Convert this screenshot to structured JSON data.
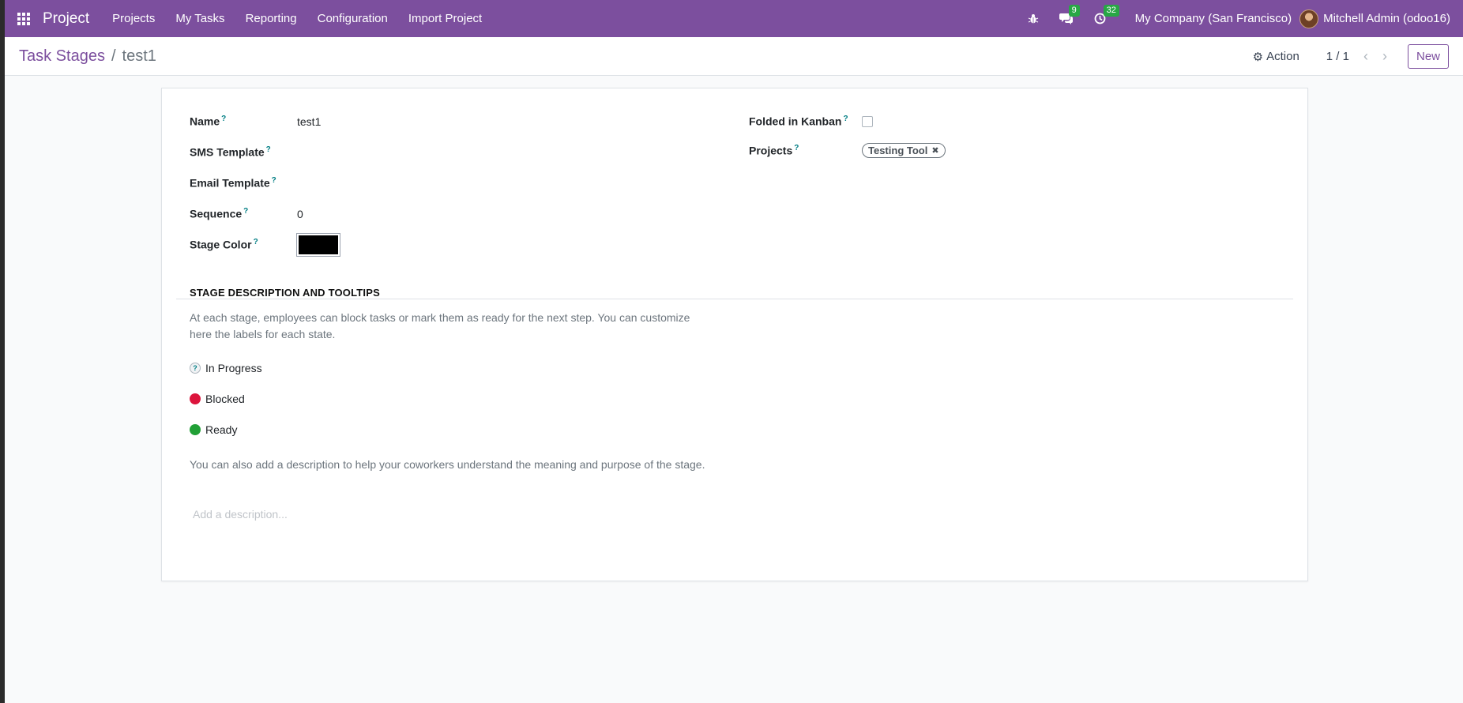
{
  "navbar": {
    "app_name": "Project",
    "menu": [
      "Projects",
      "My Tasks",
      "Reporting",
      "Configuration",
      "Import Project"
    ],
    "messages_count": "9",
    "activities_count": "32",
    "company": "My Company (San Francisco)",
    "user": "Mitchell Admin (odoo16)"
  },
  "control_panel": {
    "breadcrumb_parent": "Task Stages",
    "breadcrumb_current": "test1",
    "action_label": "Action",
    "pager": "1 / 1",
    "new_label": "New"
  },
  "form": {
    "fields_left": [
      {
        "label": "Name",
        "value": "test1"
      },
      {
        "label": "SMS Template",
        "value": ""
      },
      {
        "label": "Email Template",
        "value": ""
      },
      {
        "label": "Sequence",
        "value": "0"
      },
      {
        "label": "Stage Color",
        "value": ""
      }
    ],
    "stage_color_hex": "#000000",
    "fields_right": [
      {
        "label": "Folded in Kanban"
      },
      {
        "label": "Projects"
      }
    ],
    "help_mark": "?",
    "projects_tags": [
      "Testing Tool"
    ],
    "folded_in_kanban": false
  },
  "section": {
    "title": "STAGE DESCRIPTION AND TOOLTIPS",
    "intro": "At each stage, employees can block tasks or mark them as ready for the next step. You can customize here the labels for each state.",
    "states": [
      {
        "label": "In Progress",
        "icon": "question-circle-icon",
        "color": "#f1f3f5"
      },
      {
        "label": "Blocked",
        "icon": "red-dot",
        "color": "#dc143c"
      },
      {
        "label": "Ready",
        "icon": "green-dot",
        "color": "#21a036"
      }
    ],
    "outro": "You can also add a description to help your coworkers understand the meaning and purpose of the stage.",
    "description_placeholder": "Add a description..."
  },
  "colors": {
    "brand": "#7c4f9e",
    "help_mark": "#017e84"
  }
}
